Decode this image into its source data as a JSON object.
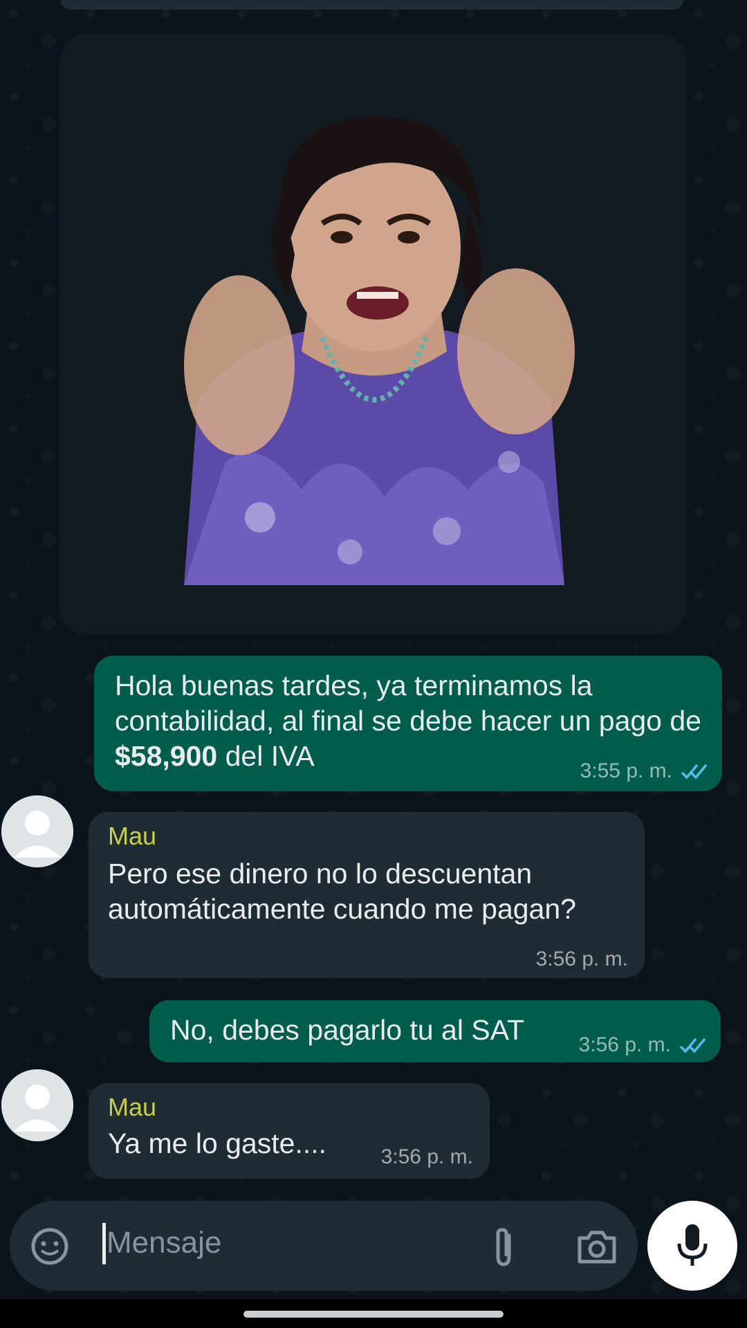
{
  "messages": [
    {
      "direction": "outgoing",
      "text_before": "Hola buenas tardes, ya terminamos la contabilidad, al final se debe hacer un pago de ",
      "text_bold": "$58,900",
      "text_after": " del IVA",
      "time": "3:55 p. m.",
      "status": "read"
    },
    {
      "direction": "incoming",
      "sender": "Mau",
      "text": "Pero ese dinero no lo descuentan automáticamente cuando me pagan?",
      "time": "3:56 p. m."
    },
    {
      "direction": "outgoing",
      "text": "No, debes pagarlo tu al SAT",
      "time": "3:56 p. m.",
      "status": "read"
    },
    {
      "direction": "incoming",
      "sender": "Mau",
      "text": "Ya me lo gaste....",
      "time": "3:56 p. m."
    }
  ],
  "composer": {
    "placeholder": "Mensaje",
    "icons": [
      "sticker-icon",
      "attach-icon",
      "camera-icon",
      "mic-icon"
    ]
  },
  "colors": {
    "background": "#0b141a",
    "outgoing_bubble": "#005c4b",
    "incoming_bubble": "#202c33",
    "sender_name": "#c7cf4b",
    "read_ticks": "#53bdeb"
  }
}
